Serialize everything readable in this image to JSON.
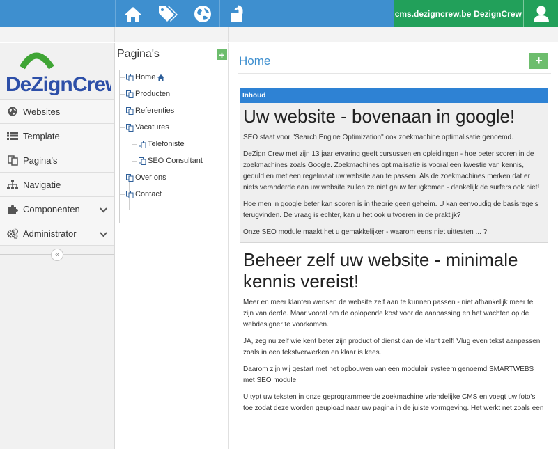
{
  "topbar": {
    "icons": [
      "home-icon",
      "tags-icon",
      "globe-icon",
      "unlock-icon"
    ],
    "domain": "cms.dezigncrew.be",
    "brand": "DezignCrew",
    "user_icon": "user-icon",
    "accent": "#3e8fcf",
    "green": "#22a05a"
  },
  "logo": {
    "text_left": "DeZign",
    "text_right": "Crew"
  },
  "sidebar": {
    "items": [
      {
        "label": "Websites",
        "icon": "globe-icon"
      },
      {
        "label": "Template",
        "icon": "list-icon"
      },
      {
        "label": "Pagina's",
        "icon": "pages-icon"
      },
      {
        "label": "Navigatie",
        "icon": "sitemap-icon"
      },
      {
        "label": "Componenten",
        "icon": "puzzle-icon",
        "expandable": true
      },
      {
        "label": "Administrator",
        "icon": "cogs-icon",
        "expandable": true
      }
    ],
    "collapse_label": "«"
  },
  "pages": {
    "title": "Pagina's",
    "add_label": "+",
    "tree": [
      {
        "label": "Home",
        "home": true
      },
      {
        "label": "Producten"
      },
      {
        "label": "Referenties"
      },
      {
        "label": "Vacatures"
      },
      {
        "label": "Telefoniste"
      },
      {
        "label": "SEO Consultant"
      },
      {
        "label": "Over ons"
      },
      {
        "label": "Contact"
      }
    ]
  },
  "main": {
    "heading": "Home",
    "add_label": "+",
    "panel_title": "Inhoud",
    "sections": [
      {
        "title": "Uw website - bovenaan in google!",
        "paragraphs": [
          "SEO staat voor \"Search Engine Optimization\" ook zoekmachine optimalisatie genoemd.",
          "DeZign Crew met zijn 13 jaar ervaring geeft cursussen en opleidingen - hoe beter scoren in de zoekmachines zoals Google. Zoekmachines optimalisatie is vooral een kwestie van kennis, geduld en met een regelmaat uw website aan te passen. Als de zoekmachines merken dat er niets veranderde aan uw website zullen ze niet gauw terugkomen - denkelijk de surfers ook niet!",
          "Hoe men in google beter kan scoren is in theorie geen geheim. U kan eenvoudig de basisregels terugvinden. De vraag is echter, kan u het ook uitvoeren in de praktijk?",
          "Onze SEO module maakt het u gemakkelijker - waarom eens niet uittesten ... ?"
        ]
      },
      {
        "title": "Beheer zelf uw website - minimale kennis vereist!",
        "paragraphs": [
          "Meer en meer klanten wensen de website zelf aan te kunnen passen - niet afhankelijk meer te zijn van derde. Maar vooral om de oplopende kost voor de aanpassing en het wachten op de webdesigner te voorkomen.",
          "JA, zeg nu zelf wie kent beter zijn product of dienst dan de klant zelf! Vlug even tekst aanpassen zoals in een tekstverwerken en klaar is kees.",
          "Daarom zijn wij gestart met het opbouwen van een modulair systeem genoemd SMARTWEBS met SEO module.",
          "U typt uw teksten in onze geprogrammeerde zoekmachine vriendelijke CMS en voegt uw foto's toe zodat deze worden geupload naar uw pagina in de juiste vormgeving. Het werkt net zoals een"
        ]
      }
    ]
  }
}
